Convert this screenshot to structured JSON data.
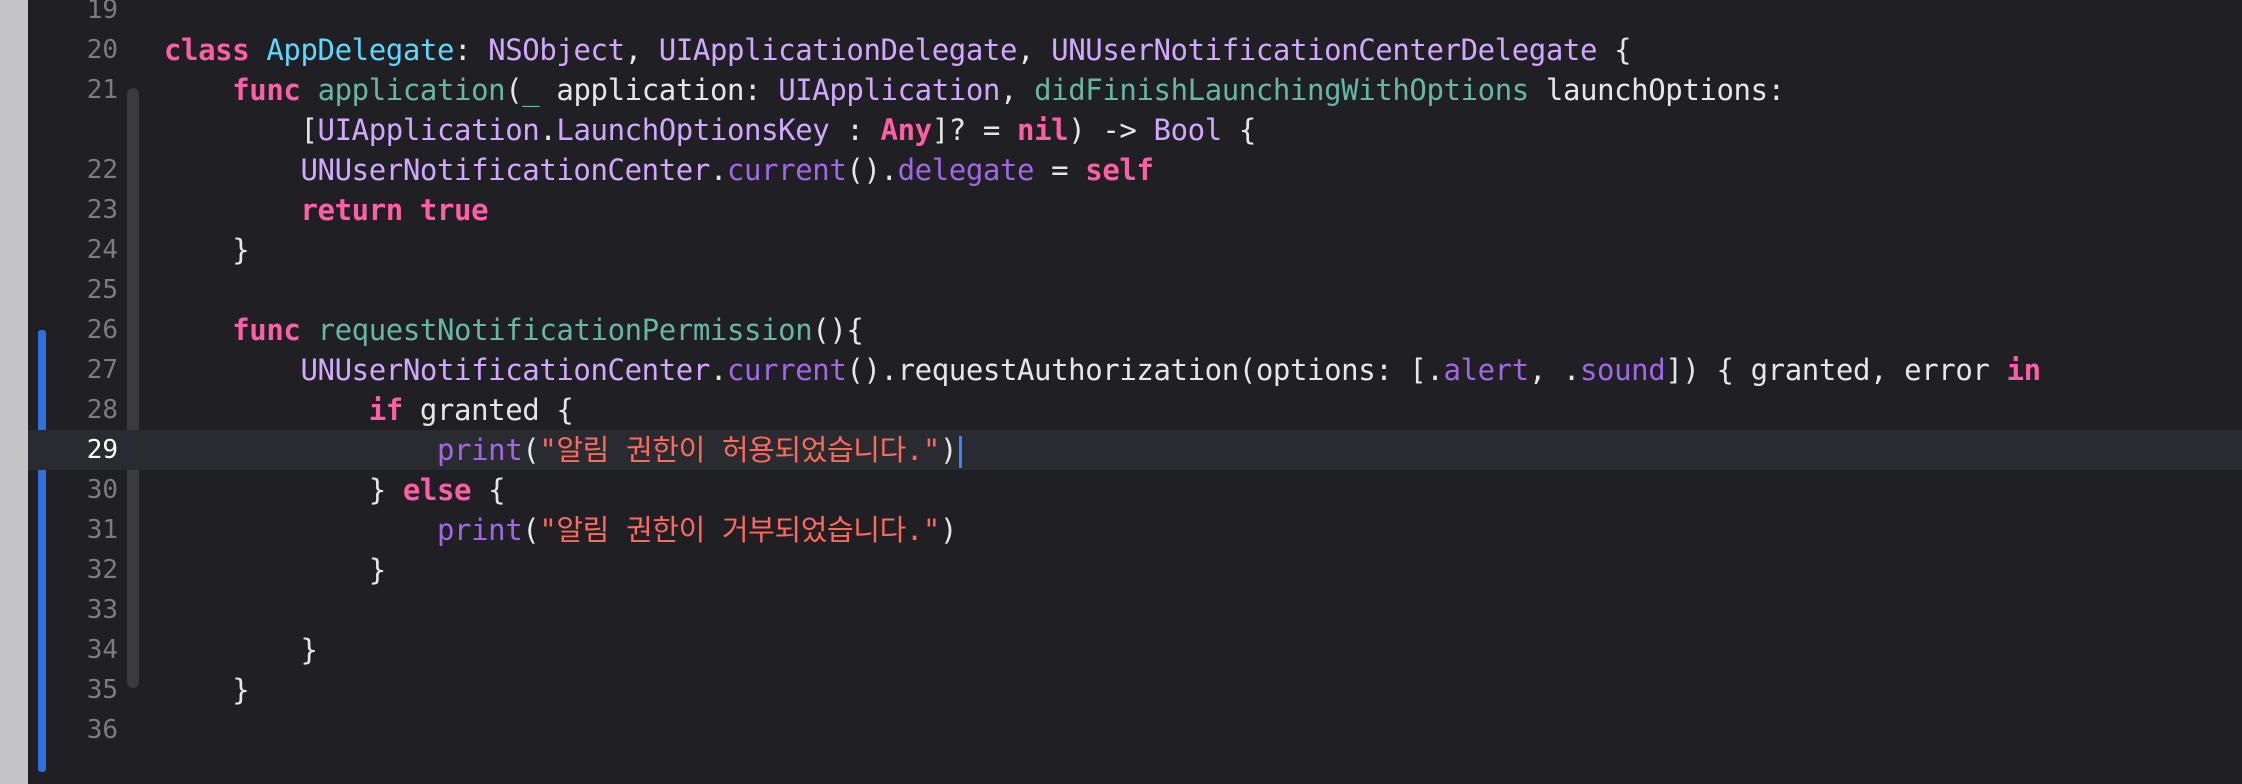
{
  "editor": {
    "lines": [
      {
        "num": "19",
        "parts": []
      },
      {
        "num": "20",
        "parts": [
          {
            "t": "class",
            "c": "kw"
          },
          {
            "t": " ",
            "c": "pln"
          },
          {
            "t": "AppDelegate",
            "c": "cls"
          },
          {
            "t": ": ",
            "c": "pln"
          },
          {
            "t": "NSObject",
            "c": "typ"
          },
          {
            "t": ", ",
            "c": "pln"
          },
          {
            "t": "UIApplicationDelegate",
            "c": "typ"
          },
          {
            "t": ", ",
            "c": "pln"
          },
          {
            "t": "UNUserNotificationCenterDelegate",
            "c": "typ"
          },
          {
            "t": " {",
            "c": "pln"
          }
        ]
      },
      {
        "num": "21",
        "parts": [
          {
            "t": "    ",
            "c": "pln"
          },
          {
            "t": "func",
            "c": "kw"
          },
          {
            "t": " ",
            "c": "pln"
          },
          {
            "t": "application",
            "c": "fn"
          },
          {
            "t": "(",
            "c": "pln"
          },
          {
            "t": "_",
            "c": "fn"
          },
          {
            "t": " application: ",
            "c": "pln"
          },
          {
            "t": "UIApplication",
            "c": "typ"
          },
          {
            "t": ", ",
            "c": "pln"
          },
          {
            "t": "didFinishLaunchingWithOptions",
            "c": "fn"
          },
          {
            "t": " launchOptions:",
            "c": "pln"
          }
        ]
      },
      {
        "num": "",
        "parts": [
          {
            "t": "        [",
            "c": "pln"
          },
          {
            "t": "UIApplication",
            "c": "typ"
          },
          {
            "t": ".",
            "c": "pln"
          },
          {
            "t": "LaunchOptionsKey",
            "c": "typ"
          },
          {
            "t": " : ",
            "c": "pln"
          },
          {
            "t": "Any",
            "c": "kw"
          },
          {
            "t": "]? = ",
            "c": "pln"
          },
          {
            "t": "nil",
            "c": "kw"
          },
          {
            "t": ") -> ",
            "c": "pln"
          },
          {
            "t": "Bool",
            "c": "typ"
          },
          {
            "t": " {",
            "c": "pln"
          }
        ]
      },
      {
        "num": "22",
        "parts": [
          {
            "t": "        ",
            "c": "pln"
          },
          {
            "t": "UNUserNotificationCenter",
            "c": "typ"
          },
          {
            "t": ".",
            "c": "pln"
          },
          {
            "t": "current",
            "c": "mth"
          },
          {
            "t": "().",
            "c": "pln"
          },
          {
            "t": "delegate",
            "c": "mth"
          },
          {
            "t": " = ",
            "c": "pln"
          },
          {
            "t": "self",
            "c": "kw"
          }
        ]
      },
      {
        "num": "23",
        "parts": [
          {
            "t": "        ",
            "c": "pln"
          },
          {
            "t": "return",
            "c": "kw"
          },
          {
            "t": " ",
            "c": "pln"
          },
          {
            "t": "true",
            "c": "kw"
          }
        ]
      },
      {
        "num": "24",
        "parts": [
          {
            "t": "    }",
            "c": "pln"
          }
        ]
      },
      {
        "num": "25",
        "parts": []
      },
      {
        "num": "26",
        "parts": [
          {
            "t": "    ",
            "c": "pln"
          },
          {
            "t": "func",
            "c": "kw"
          },
          {
            "t": " ",
            "c": "pln"
          },
          {
            "t": "requestNotificationPermission",
            "c": "fn"
          },
          {
            "t": "(){",
            "c": "pln"
          }
        ]
      },
      {
        "num": "27",
        "parts": [
          {
            "t": "        ",
            "c": "pln"
          },
          {
            "t": "UNUserNotificationCenter",
            "c": "typ"
          },
          {
            "t": ".",
            "c": "pln"
          },
          {
            "t": "current",
            "c": "mth"
          },
          {
            "t": "().requestAuthorization(options: [.",
            "c": "pln"
          },
          {
            "t": "alert",
            "c": "mth"
          },
          {
            "t": ", .",
            "c": "pln"
          },
          {
            "t": "sound",
            "c": "mth"
          },
          {
            "t": "]) { granted, error ",
            "c": "pln"
          },
          {
            "t": "in",
            "c": "kw"
          }
        ]
      },
      {
        "num": "28",
        "parts": [
          {
            "t": "            ",
            "c": "pln"
          },
          {
            "t": "if",
            "c": "kw"
          },
          {
            "t": " granted {",
            "c": "pln"
          }
        ]
      },
      {
        "num": "29",
        "current": true,
        "parts": [
          {
            "t": "                ",
            "c": "pln"
          },
          {
            "t": "print",
            "c": "mth"
          },
          {
            "t": "(",
            "c": "pln"
          },
          {
            "t": "\"알림 권한이 허용되었습니다.\"",
            "c": "str"
          },
          {
            "t": ")",
            "c": "pln"
          }
        ]
      },
      {
        "num": "30",
        "parts": [
          {
            "t": "            } ",
            "c": "pln"
          },
          {
            "t": "else",
            "c": "kw"
          },
          {
            "t": " {",
            "c": "pln"
          }
        ]
      },
      {
        "num": "31",
        "parts": [
          {
            "t": "                ",
            "c": "pln"
          },
          {
            "t": "print",
            "c": "mth"
          },
          {
            "t": "(",
            "c": "pln"
          },
          {
            "t": "\"알림 권한이 거부되었습니다.\"",
            "c": "str"
          },
          {
            "t": ")",
            "c": "pln"
          }
        ]
      },
      {
        "num": "32",
        "parts": [
          {
            "t": "            }",
            "c": "pln"
          }
        ]
      },
      {
        "num": "33",
        "parts": []
      },
      {
        "num": "34",
        "parts": [
          {
            "t": "        }",
            "c": "pln"
          }
        ]
      },
      {
        "num": "35",
        "parts": [
          {
            "t": "    }",
            "c": "pln"
          }
        ]
      },
      {
        "num": "36",
        "parts": []
      }
    ]
  },
  "colors": {
    "background": "#1f1f24",
    "keyword": "#fc5fa3",
    "class_name": "#5dd8ff",
    "type": "#d0a8ff",
    "function": "#67b7a4",
    "method": "#a167e6",
    "string": "#fc6a5d",
    "change_bar": "#2f6fde",
    "cursor": "#3a82ff"
  }
}
